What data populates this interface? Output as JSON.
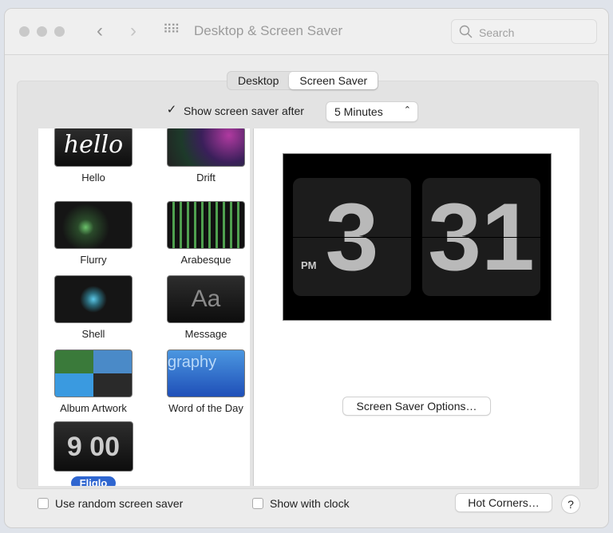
{
  "window": {
    "title": "Desktop & Screen Saver",
    "search_placeholder": "Search"
  },
  "tabs": [
    {
      "label": "Desktop",
      "selected": false
    },
    {
      "label": "Screen Saver",
      "selected": true
    }
  ],
  "show_after": {
    "label": "Show screen saver after",
    "checked": true,
    "value": "5 Minutes"
  },
  "savers": [
    {
      "label": "Hello",
      "thumb_text": "hello"
    },
    {
      "label": "Drift"
    },
    {
      "label": "Flurry"
    },
    {
      "label": "Arabesque"
    },
    {
      "label": "Shell"
    },
    {
      "label": "Message",
      "thumb_text": "Aa"
    },
    {
      "label": "Album Artwork"
    },
    {
      "label": "Word of the Day",
      "thumb_text": "graphy"
    },
    {
      "label": "Fliqlo",
      "thumb_text": "9 00",
      "selected": true
    }
  ],
  "preview": {
    "hour": "3",
    "minute": "31",
    "ampm": "PM"
  },
  "options_button": "Screen Saver Options…",
  "bottom": {
    "random_label": "Use random screen saver",
    "random_checked": false,
    "clock_label": "Show with clock",
    "clock_checked": false,
    "hot_corners": "Hot Corners…",
    "help": "?"
  }
}
